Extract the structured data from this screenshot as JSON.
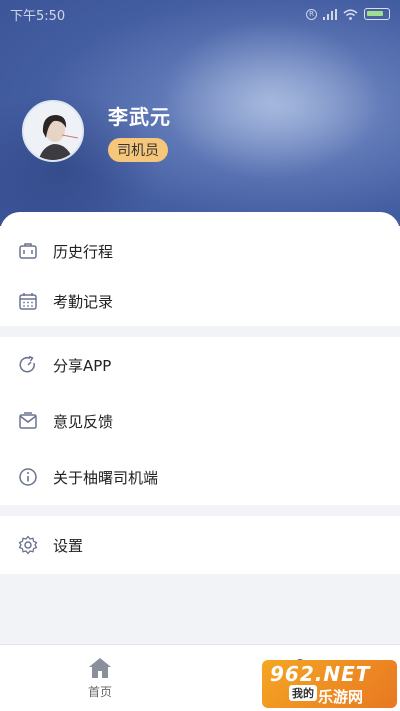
{
  "status_bar": {
    "time": "下午5:50",
    "r_badge": "R"
  },
  "profile": {
    "name": "李武元",
    "role": "司机员"
  },
  "menu": {
    "group1": [
      {
        "icon": "briefcase-icon",
        "label": "历史行程"
      },
      {
        "icon": "calendar-icon",
        "label": "考勤记录"
      }
    ],
    "group2": [
      {
        "icon": "share-icon",
        "label": "分享APP"
      },
      {
        "icon": "mail-icon",
        "label": "意见反馈"
      },
      {
        "icon": "info-icon",
        "label": "关于柚曙司机端"
      }
    ],
    "group3": [
      {
        "icon": "gear-icon",
        "label": "设置"
      }
    ]
  },
  "tabbar": {
    "home": "首页",
    "mine": "我的"
  },
  "watermark": {
    "top": "962.NET",
    "bottom": "乐游网",
    "badge": "我的"
  },
  "colors": {
    "header_blue": "#445ea2",
    "badge_gold": "#f6c77a",
    "icon_gray": "#6b7391"
  }
}
